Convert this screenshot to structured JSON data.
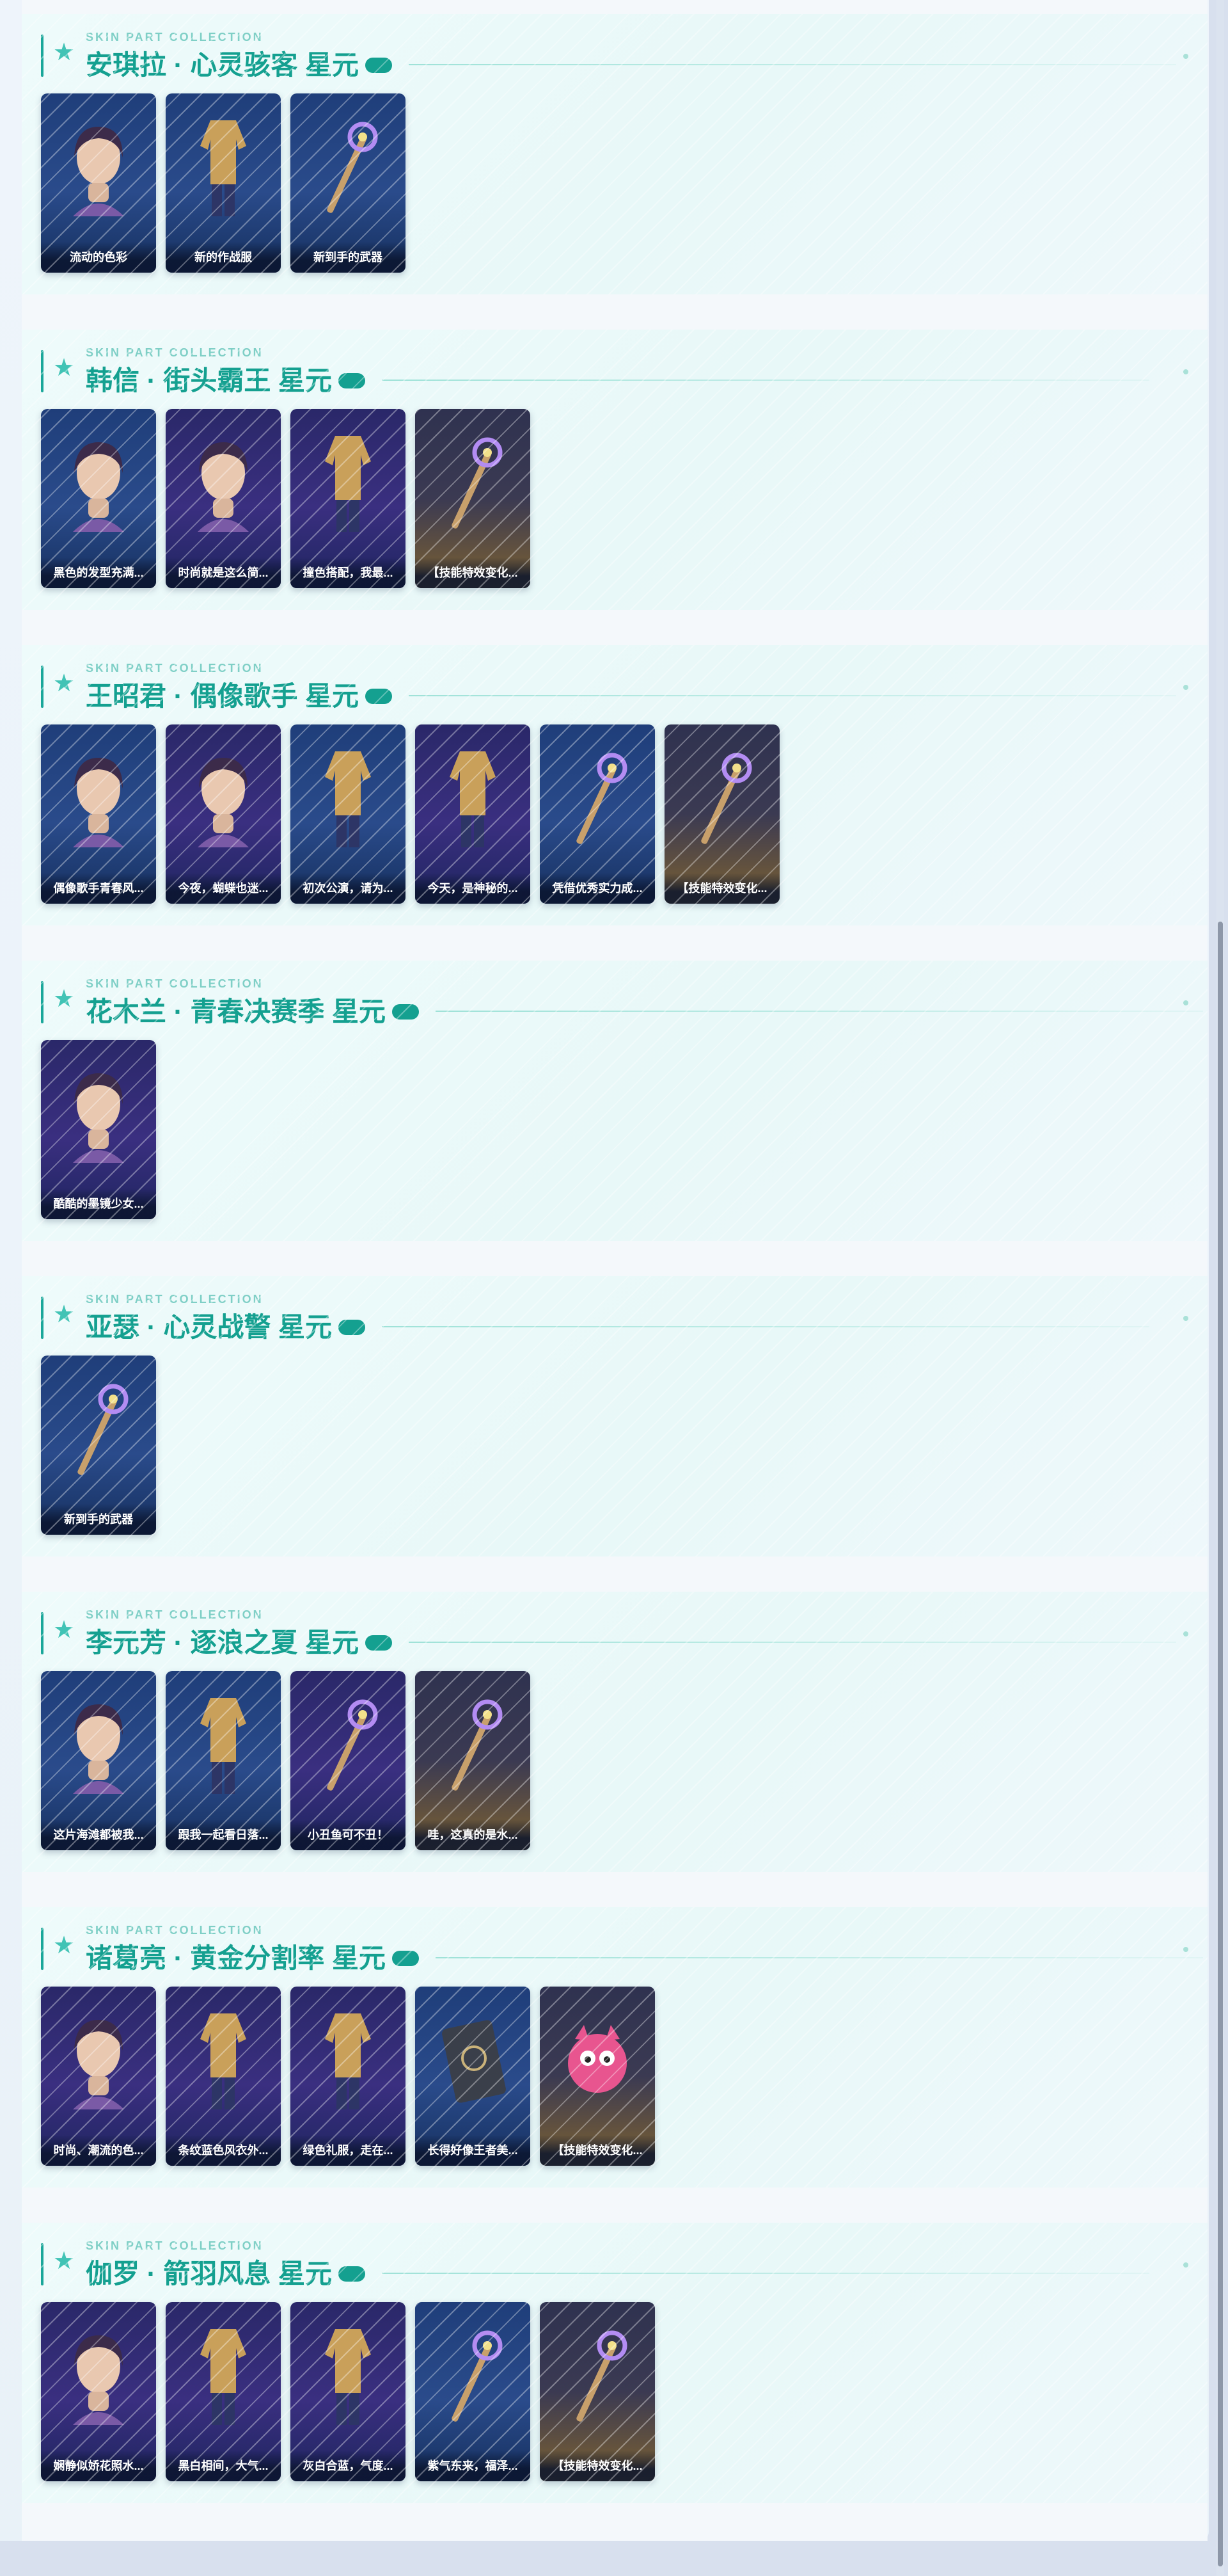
{
  "sections": [
    {
      "eyebrow": "SKIN PART COLLECTION",
      "title": "安琪拉 · 心灵骇客 星元",
      "cards": [
        {
          "label": "流动的色彩",
          "theme": "blue",
          "icon": "hero-head-icon"
        },
        {
          "label": "新的作战服",
          "theme": "blue",
          "icon": "outfit-icon"
        },
        {
          "label": "新到手的武器",
          "theme": "blue",
          "icon": "weapon-icon"
        }
      ]
    },
    {
      "eyebrow": "SKIN PART COLLECTION",
      "title": "韩信 · 街头霸王 星元",
      "cards": [
        {
          "label": "黑色的发型充满...",
          "theme": "blue",
          "icon": "hero-head-icon"
        },
        {
          "label": "时尚就是这么简...",
          "theme": "purple",
          "icon": "hero-head-icon"
        },
        {
          "label": "撞色搭配，我最...",
          "theme": "purple",
          "icon": "outfit-icon"
        },
        {
          "label": "【技能特效变化...",
          "theme": "gold",
          "icon": "weapon-icon"
        }
      ]
    },
    {
      "eyebrow": "SKIN PART COLLECTION",
      "title": "王昭君 · 偶像歌手 星元",
      "cards": [
        {
          "label": "偶像歌手青春风...",
          "theme": "blue",
          "icon": "hero-head-icon"
        },
        {
          "label": "今夜，蝴蝶也迷...",
          "theme": "purple",
          "icon": "hero-head-icon"
        },
        {
          "label": "初次公演，请为...",
          "theme": "blue",
          "icon": "outfit-icon"
        },
        {
          "label": "今天，是神秘的...",
          "theme": "purple",
          "icon": "outfit-icon"
        },
        {
          "label": "凭借优秀实力成...",
          "theme": "blue",
          "icon": "weapon-icon"
        },
        {
          "label": "【技能特效变化...",
          "theme": "gold",
          "icon": "weapon-icon"
        }
      ]
    },
    {
      "eyebrow": "SKIN PART COLLECTION",
      "title": "花木兰 · 青春决赛季 星元",
      "cards": [
        {
          "label": "酷酷的墨镜少女...",
          "theme": "purple",
          "icon": "hero-head-icon"
        }
      ]
    },
    {
      "eyebrow": "SKIN PART COLLECTION",
      "title": "亚瑟 · 心灵战警 星元",
      "cards": [
        {
          "label": "新到手的武器",
          "theme": "blue",
          "icon": "weapon-icon"
        }
      ]
    },
    {
      "eyebrow": "SKIN PART COLLECTION",
      "title": "李元芳 · 逐浪之夏 星元",
      "cards": [
        {
          "label": "这片海滩都被我...",
          "theme": "blue",
          "icon": "hero-head-icon"
        },
        {
          "label": "跟我一起看日落...",
          "theme": "blue",
          "icon": "outfit-icon"
        },
        {
          "label": "小丑鱼可不丑！",
          "theme": "purple",
          "icon": "weapon-icon"
        },
        {
          "label": "哇，这真的是水...",
          "theme": "gold",
          "icon": "weapon-icon"
        }
      ]
    },
    {
      "eyebrow": "SKIN PART COLLECTION",
      "title": "诸葛亮 · 黄金分割率 星元",
      "cards": [
        {
          "label": "时尚、潮流的色...",
          "theme": "purple",
          "icon": "hero-head-icon"
        },
        {
          "label": "条纹蓝色风衣外...",
          "theme": "purple",
          "icon": "outfit-icon"
        },
        {
          "label": "绿色礼服，走在...",
          "theme": "purple",
          "icon": "outfit-icon"
        },
        {
          "label": "长得好像王者美...",
          "theme": "blue",
          "icon": "book-icon"
        },
        {
          "label": "【技能特效变化...",
          "theme": "gold",
          "icon": "mascot-icon"
        }
      ]
    },
    {
      "eyebrow": "SKIN PART COLLECTION",
      "title": "伽罗 · 箭羽风息 星元",
      "cards": [
        {
          "label": "娴静似娇花照水...",
          "theme": "purple",
          "icon": "hero-head-icon"
        },
        {
          "label": "黑白相间，大气...",
          "theme": "purple",
          "icon": "outfit-icon"
        },
        {
          "label": "灰白合蓝，气度...",
          "theme": "purple",
          "icon": "outfit-icon"
        },
        {
          "label": "紫气东来，福泽...",
          "theme": "blue",
          "icon": "weapon-icon"
        },
        {
          "label": "【技能特效变化...",
          "theme": "gold",
          "icon": "weapon-icon"
        }
      ]
    }
  ]
}
